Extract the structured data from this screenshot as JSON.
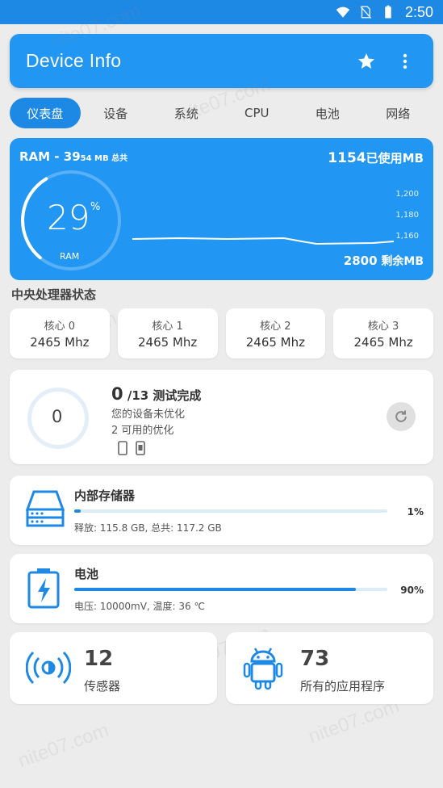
{
  "status_bar": {
    "time": "2:50"
  },
  "app": {
    "title": "Device Info"
  },
  "tabs": [
    {
      "label": "仪表盘",
      "active": true
    },
    {
      "label": "设备",
      "active": false
    },
    {
      "label": "系统",
      "active": false
    },
    {
      "label": "CPU",
      "active": false
    },
    {
      "label": "电池",
      "active": false
    },
    {
      "label": "网络",
      "active": false
    }
  ],
  "ram": {
    "label": "RAM - 39",
    "total_small": "54 MB 总共",
    "used_value": "1154",
    "used_label": "已使用MB",
    "percent": "29",
    "percent_symbol": "%",
    "gauge_label": "RAM",
    "remaining_value": "2800",
    "remaining_label": " 剩余MB",
    "axis_ticks": [
      "1,200",
      "1,180",
      "1,160"
    ],
    "percent_fraction": 0.29
  },
  "cpu": {
    "section_title": "中央处理器状态",
    "cores": [
      {
        "name": "核心 0",
        "freq": "2465 Mhz"
      },
      {
        "name": "核心 1",
        "freq": "2465 Mhz"
      },
      {
        "name": "核心 2",
        "freq": "2465 Mhz"
      },
      {
        "name": "核心 3",
        "freq": "2465 Mhz"
      }
    ]
  },
  "optimize": {
    "ring_value": "0",
    "count_value": "0",
    "count_total": " /13",
    "count_label": " 测试完成",
    "line1": "您的设备未优化",
    "line2": "2 可用的优化"
  },
  "storage": {
    "title": "内部存储器",
    "percent_text": "1%",
    "percent_fraction": 0.01,
    "detail": "释放: 115.8 GB,  总共: 117.2 GB"
  },
  "battery": {
    "title": "电池",
    "percent_text": "90%",
    "percent_fraction": 0.9,
    "detail": "电压: 10000mV,  温度: 36 ℃"
  },
  "sensors": {
    "value": "12",
    "label": "传感器"
  },
  "apps": {
    "value": "73",
    "label": "所有的应用程序"
  },
  "watermark": "nite07.com",
  "colors": {
    "primary": "#2196f3",
    "primary_dark": "#1e88e5",
    "background": "#ececec"
  }
}
